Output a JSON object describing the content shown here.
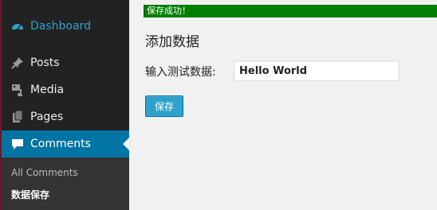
{
  "sidebar": {
    "items": [
      {
        "id": "dashboard",
        "label": "Dashboard",
        "icon": "dashboard-icon"
      },
      {
        "id": "posts",
        "label": "Posts",
        "icon": "pin-icon"
      },
      {
        "id": "media",
        "label": "Media",
        "icon": "media-icon"
      },
      {
        "id": "pages",
        "label": "Pages",
        "icon": "pages-icon"
      },
      {
        "id": "comments",
        "label": "Comments",
        "icon": "comment-icon",
        "active": true
      }
    ],
    "submenu": [
      {
        "label": "All Comments"
      },
      {
        "label": "数据保存",
        "current": true
      }
    ]
  },
  "notice": {
    "text": "保存成功！"
  },
  "main": {
    "title": "添加数据",
    "field": {
      "label": "输入测试数据:",
      "value": "Hello World"
    },
    "save_label": "保存"
  },
  "colors": {
    "sidebar_bg": "#222222",
    "accent": "#0074a2",
    "link": "#2ea2cc",
    "notice_bg": "#008000",
    "button": "#2ea2cc"
  }
}
